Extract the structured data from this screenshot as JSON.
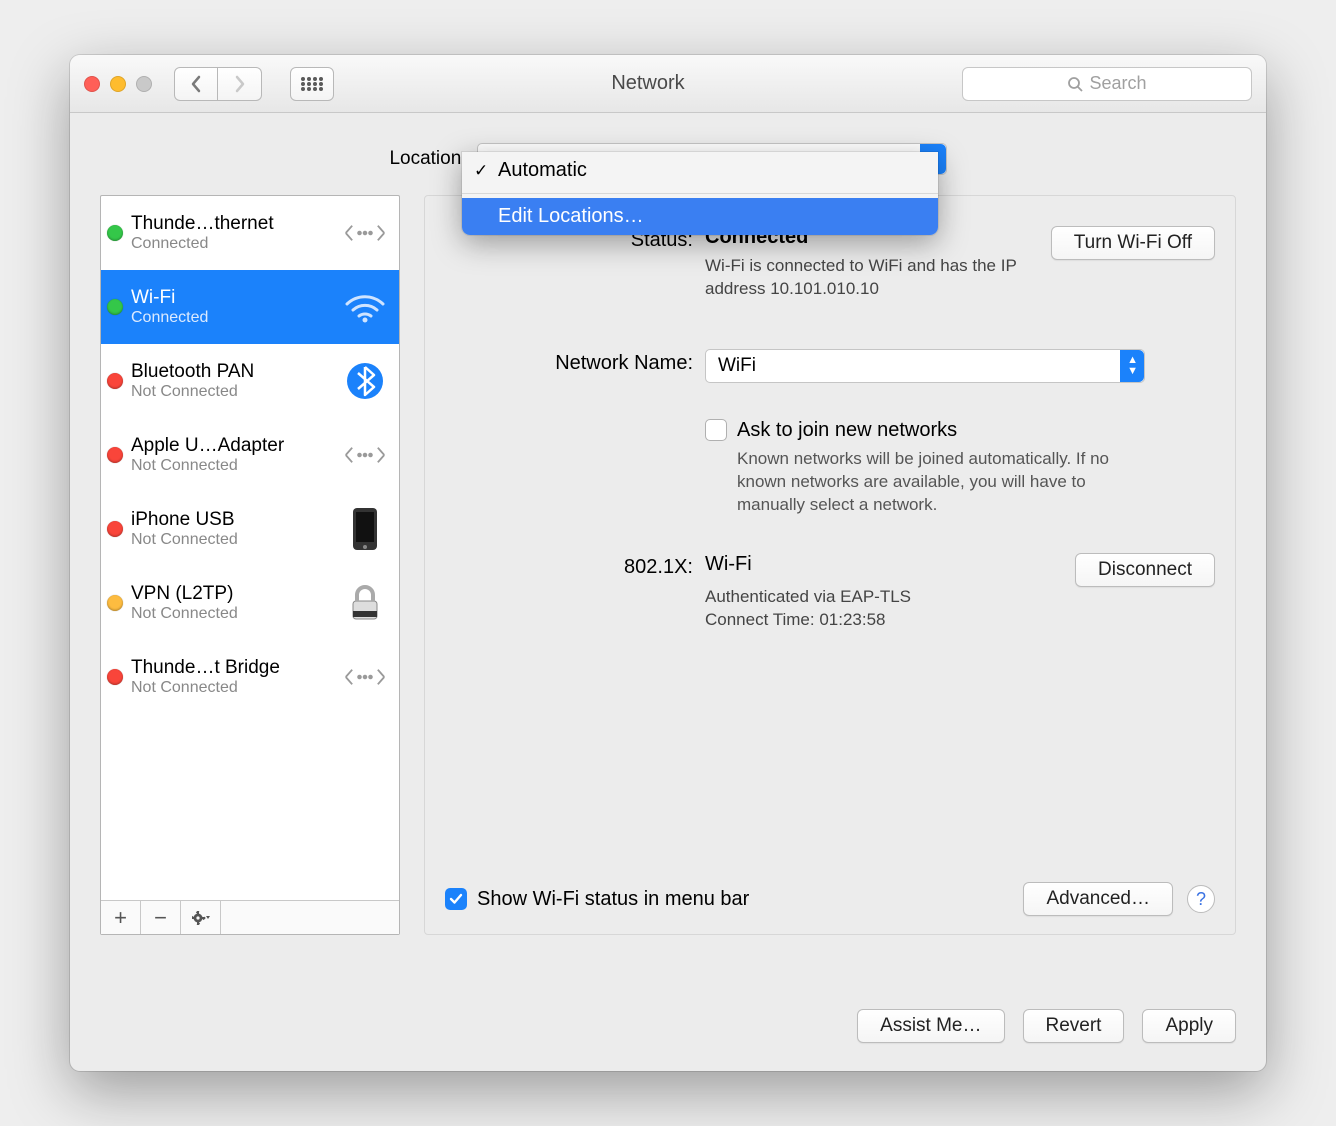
{
  "window": {
    "title": "Network"
  },
  "search": {
    "placeholder": "Search"
  },
  "location": {
    "label": "Location:",
    "selected": "Automatic",
    "menu": {
      "items": [
        {
          "label": "Automatic",
          "checked": true,
          "highlighted": false
        },
        {
          "label": "Edit Locations…",
          "checked": false,
          "highlighted": true
        }
      ]
    }
  },
  "sidebar": {
    "services": [
      {
        "name": "Thunde…thernet",
        "status": "Connected",
        "dot": "green",
        "icon": "ethernet"
      },
      {
        "name": "Wi-Fi",
        "status": "Connected",
        "dot": "green",
        "icon": "wifi",
        "selected": true
      },
      {
        "name": "Bluetooth PAN",
        "status": "Not Connected",
        "dot": "red",
        "icon": "bluetooth"
      },
      {
        "name": "Apple U…Adapter",
        "status": "Not Connected",
        "dot": "red",
        "icon": "ethernet"
      },
      {
        "name": "iPhone USB",
        "status": "Not Connected",
        "dot": "red",
        "icon": "iphone"
      },
      {
        "name": "VPN (L2TP)",
        "status": "Not Connected",
        "dot": "yellow",
        "icon": "lock"
      },
      {
        "name": "Thunde…t Bridge",
        "status": "Not Connected",
        "dot": "red",
        "icon": "ethernet"
      }
    ]
  },
  "detail": {
    "status": {
      "label": "Status:",
      "value": "Connected",
      "button": "Turn Wi-Fi Off",
      "desc": "Wi-Fi is connected to WiFi and has the IP address 10.101.010.10"
    },
    "network_name": {
      "label": "Network Name:",
      "value": "WiFi"
    },
    "ask_join": {
      "label": "Ask to join new networks",
      "checked": false,
      "desc": "Known networks will be joined automatically. If no known networks are available, you will have to manually select a network."
    },
    "dot1x": {
      "label": "802.1X:",
      "value": "Wi-Fi",
      "button": "Disconnect",
      "auth_line": "Authenticated via EAP-TLS",
      "time_line": "Connect Time: 01:23:58"
    },
    "show_status": {
      "label": "Show Wi-Fi status in menu bar",
      "checked": true
    },
    "advanced_button": "Advanced…"
  },
  "bottom": {
    "assist": "Assist Me…",
    "revert": "Revert",
    "apply": "Apply"
  }
}
